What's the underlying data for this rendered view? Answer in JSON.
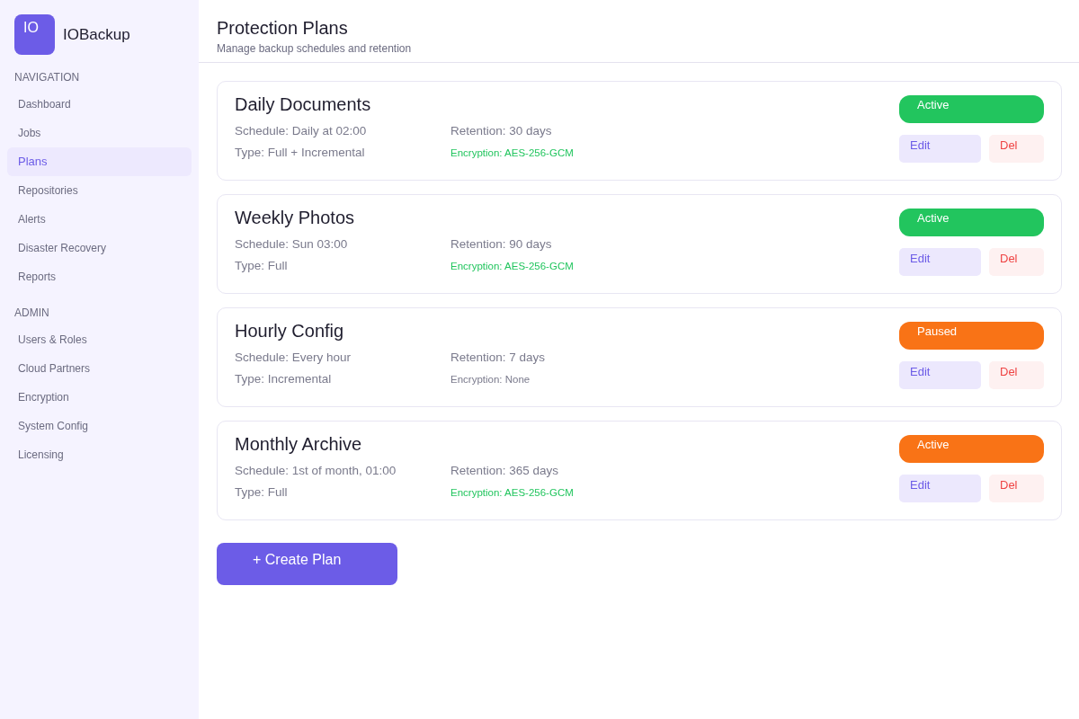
{
  "sidebar": {
    "logo": {
      "mark": "IO",
      "name": "IOBackup"
    },
    "sections": [
      {
        "heading": "NAVIGATION",
        "items": [
          {
            "label": "Dashboard",
            "selected": false
          },
          {
            "label": "Jobs",
            "selected": false
          },
          {
            "label": "Plans",
            "selected": true
          },
          {
            "label": "Repositories",
            "selected": false
          },
          {
            "label": "Alerts",
            "selected": false
          },
          {
            "label": "Disaster Recovery",
            "selected": false
          },
          {
            "label": "Reports",
            "selected": false
          }
        ]
      },
      {
        "heading": "ADMIN",
        "items": [
          {
            "label": "Users & Roles",
            "selected": false
          },
          {
            "label": "Cloud Partners",
            "selected": false
          },
          {
            "label": "Encryption",
            "selected": false
          },
          {
            "label": "System Config",
            "selected": false
          },
          {
            "label": "Licensing",
            "selected": false
          }
        ]
      }
    ]
  },
  "header": {
    "title": "Protection Plans",
    "subtitle": "Manage backup schedules and retention"
  },
  "plans": [
    {
      "name": "Daily Documents",
      "schedule": "Schedule: Daily at 02:00",
      "retention": "Retention: 30 days",
      "type": "Type: Full + Incremental",
      "encryption": {
        "text": "Encryption: AES-256-GCM",
        "enabled": true
      },
      "status": {
        "label": "Active",
        "color": "#22c55e"
      },
      "actions": [
        "Edit",
        "Del"
      ]
    },
    {
      "name": "Weekly Photos",
      "schedule": "Schedule: Sun 03:00",
      "retention": "Retention: 90 days",
      "type": "Type: Full",
      "encryption": {
        "text": "Encryption: AES-256-GCM",
        "enabled": true
      },
      "status": {
        "label": "Active",
        "color": "#22c55e"
      },
      "actions": [
        "Edit",
        "Del"
      ]
    },
    {
      "name": "Hourly Config",
      "schedule": "Schedule: Every hour",
      "retention": "Retention: 7 days",
      "type": "Type: Incremental",
      "encryption": {
        "text": "Encryption: None",
        "enabled": false
      },
      "status": {
        "label": "Paused",
        "color": "#f97316"
      },
      "actions": [
        "Edit",
        "Del"
      ]
    },
    {
      "name": "Monthly Archive",
      "schedule": "Schedule: 1st of month, 01:00",
      "retention": "Retention: 365 days",
      "type": "Type: Full",
      "encryption": {
        "text": "Encryption: AES-256-GCM",
        "enabled": true
      },
      "status": {
        "label": "Active",
        "color": "#f97316"
      },
      "actions": [
        "Edit",
        "Del"
      ]
    }
  ],
  "create_button": "+ Create Plan"
}
